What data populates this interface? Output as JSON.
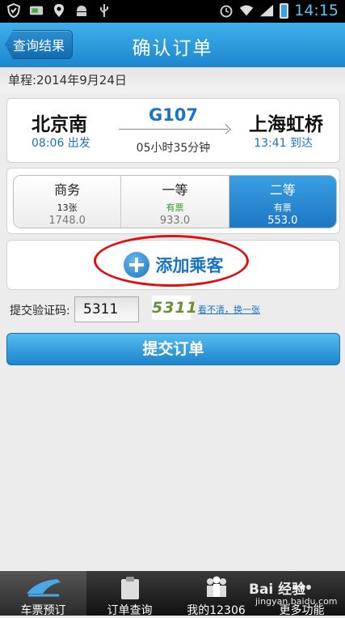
{
  "status_bar": {
    "time": "14:15",
    "icons": [
      "shield-icon",
      "sim-icon",
      "location-icon",
      "android-icon",
      "usb-icon",
      "alarm-icon",
      "wifi-icon",
      "signal-icon",
      "battery-icon"
    ]
  },
  "header": {
    "back_label": "查询结果",
    "title": "确认订单"
  },
  "trip": {
    "date_label": "单程:2014年9月24日"
  },
  "train": {
    "from_station": "北京南",
    "from_time": "08:06 出发",
    "number": "G107",
    "duration": "05小时35分钟",
    "to_station": "上海虹桥",
    "to_time": "13:41 到达"
  },
  "seats": [
    {
      "name": "商务",
      "availability": "13张",
      "price": "1748.0",
      "selected": false
    },
    {
      "name": "一等",
      "availability": "有票",
      "price": "933.0",
      "selected": false
    },
    {
      "name": "二等",
      "availability": "有票",
      "price": "553.0",
      "selected": true
    }
  ],
  "add_passenger": {
    "label": "添加乘客"
  },
  "captcha": {
    "label": "提交验证码:",
    "value": "5311",
    "image_text": "5311",
    "refresh_label": "看不清，换一张"
  },
  "submit": {
    "label": "提交订单"
  },
  "tabs": [
    {
      "label": "车票预订",
      "icon": "train-icon",
      "active": true
    },
    {
      "label": "订单查询",
      "icon": "clipboard-icon",
      "active": false
    },
    {
      "label": "我的12306",
      "icon": "people-icon",
      "active": false
    },
    {
      "label": "更多功能",
      "icon": "more-icon",
      "active": false
    }
  ],
  "watermark": {
    "text": "Bai 经验",
    "sub": "jingyan.baidu.com"
  },
  "colors": {
    "accent": "#1a74c4",
    "header": "#2a9ae0",
    "highlight": "#e01010"
  }
}
